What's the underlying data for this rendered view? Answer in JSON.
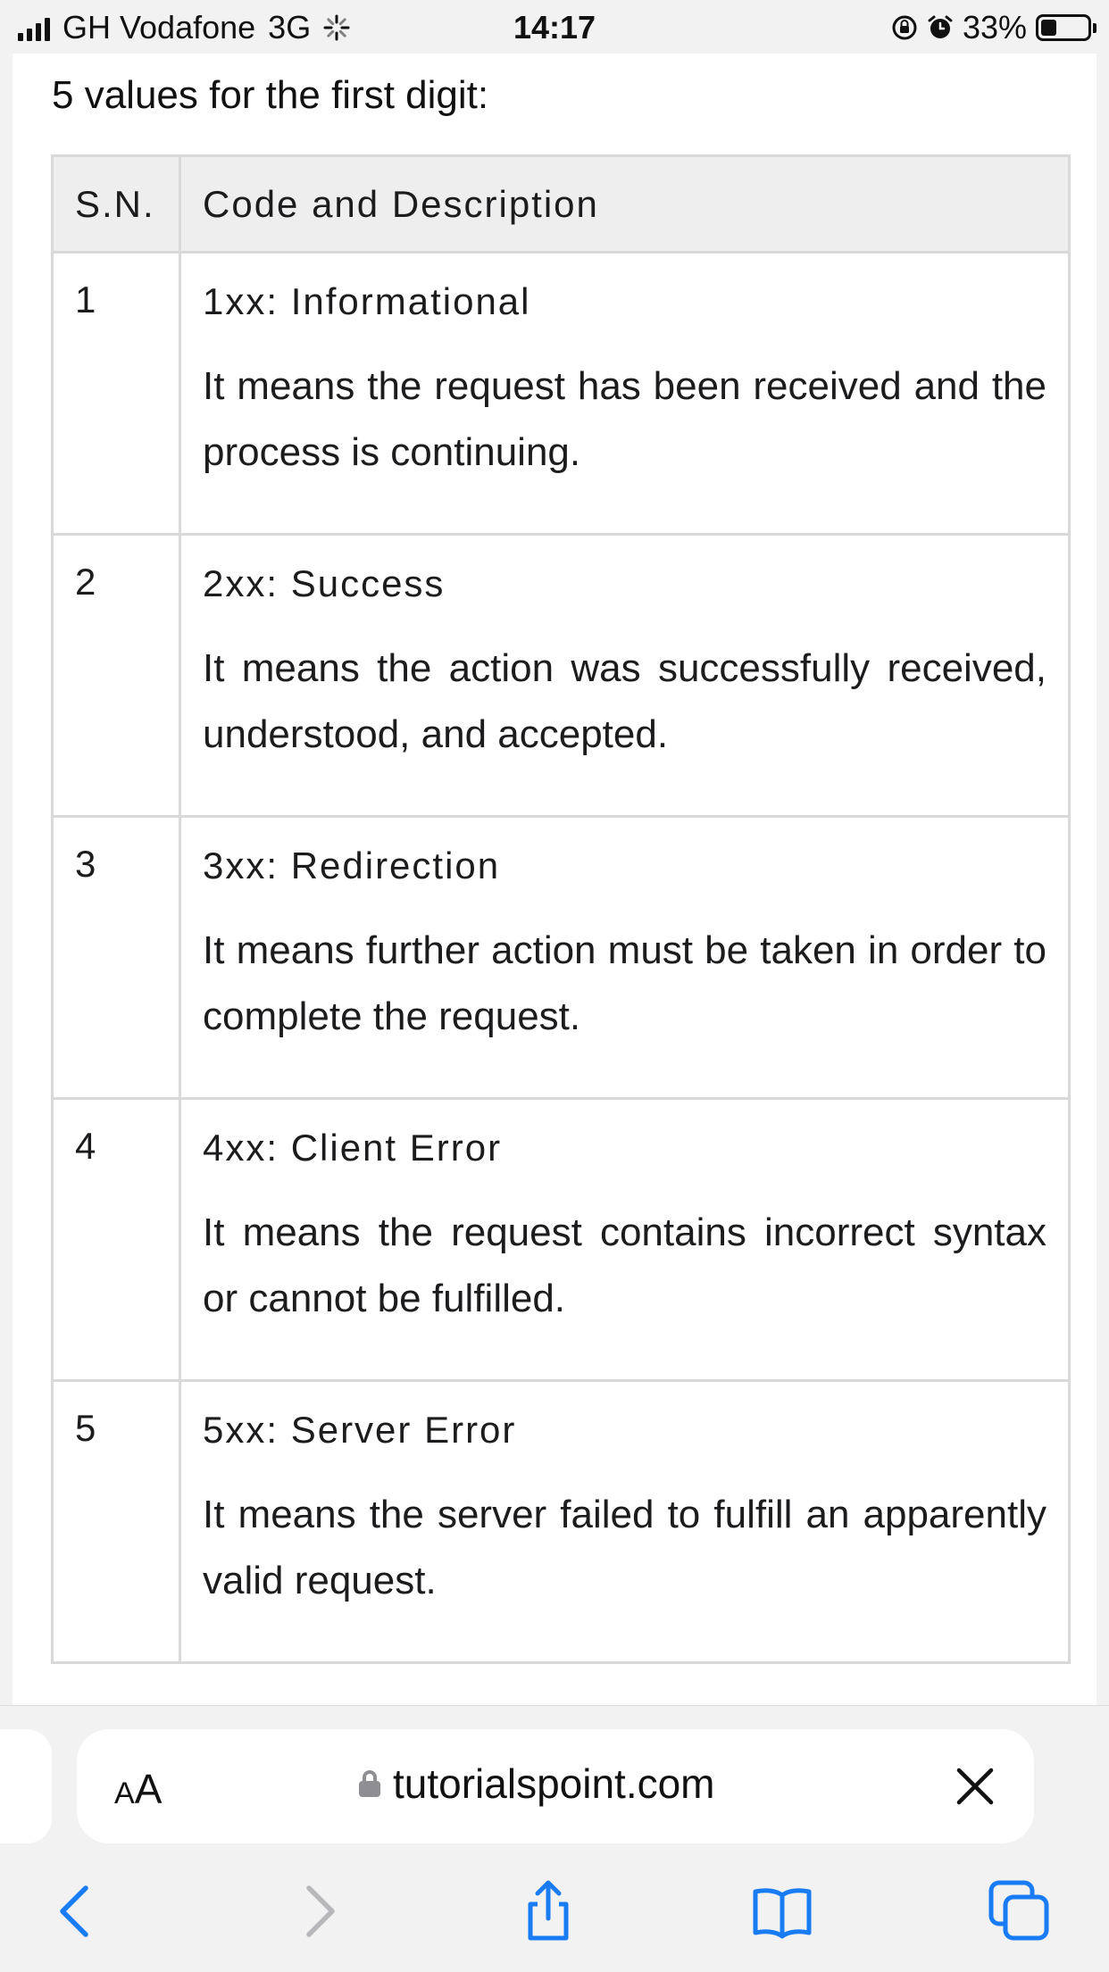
{
  "status_bar": {
    "carrier": "GH Vodafone",
    "network": "3G",
    "time": "14:17",
    "battery": "33%",
    "battery_level": 0.33,
    "icons": [
      "signal-icon",
      "loading-icon",
      "orientation-lock-icon",
      "alarm-icon",
      "battery-icon"
    ]
  },
  "page": {
    "intro": "5 values for the first digit:",
    "table": {
      "headers": [
        "S.N.",
        "Code and Description"
      ],
      "rows": [
        {
          "sn": "1",
          "code": "1xx: Informational",
          "description": "It means the request has been received and the process is continuing."
        },
        {
          "sn": "2",
          "code": "2xx: Success",
          "description": "It means the action was successfully received, understood, and accepted."
        },
        {
          "sn": "3",
          "code": "3xx: Redirection",
          "description": "It means further action must be taken in order to complete the request."
        },
        {
          "sn": "4",
          "code": "4xx: Client Error",
          "description": "It means the request contains incorrect syntax or cannot be fulfilled."
        },
        {
          "sn": "5",
          "code": "5xx: Server Error",
          "description": "It means the server failed to fulfill an apparently valid request."
        }
      ]
    }
  },
  "browser": {
    "aa_small": "A",
    "aa_large": "A",
    "url": "tutorialspoint.com",
    "icons": [
      "lock-icon",
      "close-icon",
      "back-icon",
      "forward-icon",
      "share-icon",
      "bookmarks-icon",
      "tabs-icon"
    ],
    "accent_color": "#1a7cf5",
    "disabled_color": "#b8b8bc"
  }
}
